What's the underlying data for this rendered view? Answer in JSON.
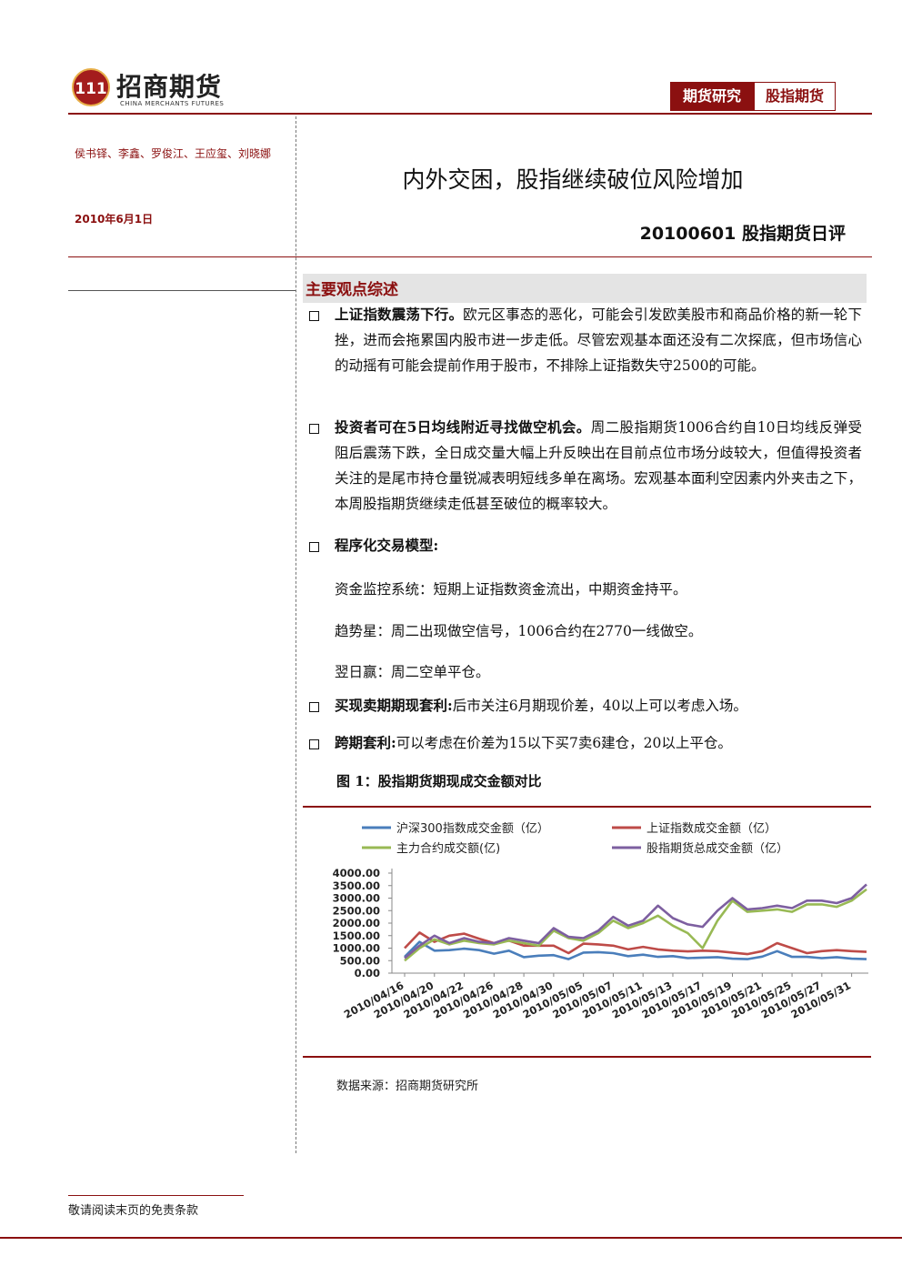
{
  "header": {
    "brand": "招商期货",
    "brand_en": "CHINA MERCHANTS FUTURES",
    "tag_primary": "期货研究",
    "tag_secondary": "股指期货"
  },
  "authors": "侯书铎、李鑫、罗俊江、王应玺、刘晓娜",
  "date": "2010年6月1日",
  "title": "内外交困，股指继续破位风险增加",
  "subtitle": "20100601 股指期货日评",
  "section_title": "主要观点综述",
  "points": [
    {
      "lead": "上证指数震荡下行。",
      "text": "欧元区事态的恶化，可能会引发欧美股市和商品价格的新一轮下挫，进而会拖累国内股市进一步走低。尽管宏观基本面还没有二次探底，但市场信心的动摇有可能会提前作用于股市，不排除上证指数失守2500的可能。"
    },
    {
      "lead": "投资者可在5日均线附近寻找做空机会。",
      "text": "周二股指期货1006合约自10日均线反弹受阻后震荡下跌，全日成交量大幅上升反映出在目前点位市场分歧较大，但值得投资者关注的是尾市持仓量锐减表明短线多单在离场。宏观基本面利空因素内外夹击之下，本周股指期货继续走低甚至破位的概率较大。"
    },
    {
      "lead": "程序化交易模型:",
      "text": ""
    }
  ],
  "model_lines": [
    "资金监控系统：短期上证指数资金流出，中期资金持平。",
    "趋势星：周二出现做空信号，1006合约在2770一线做空。",
    "翌日赢：周二空单平仓。"
  ],
  "arbitrage": [
    {
      "lead": "买现卖期期现套利:",
      "text": "后市关注6月期现价差，40以上可以考虑入场。"
    },
    {
      "lead": "跨期套利:",
      "text": "可以考虑在价差为15以下买7卖6建仓，20以上平仓。"
    }
  ],
  "figure_title": "图 1：股指期货期现成交金额对比",
  "chart_data": {
    "type": "line",
    "x": [
      "2010/04/16",
      "2010/04/19",
      "2010/04/20",
      "2010/04/21",
      "2010/04/22",
      "2010/04/23",
      "2010/04/26",
      "2010/04/27",
      "2010/04/28",
      "2010/04/29",
      "2010/04/30",
      "2010/05/04",
      "2010/05/05",
      "2010/05/06",
      "2010/05/07",
      "2010/05/10",
      "2010/05/11",
      "2010/05/12",
      "2010/05/13",
      "2010/05/14",
      "2010/05/17",
      "2010/05/18",
      "2010/05/19",
      "2010/05/20",
      "2010/05/21",
      "2010/05/24",
      "2010/05/25",
      "2010/05/26",
      "2010/05/27",
      "2010/05/28",
      "2010/05/31",
      "2010/06/01"
    ],
    "tick_labels": [
      "2010/04/16",
      "2010/04/20",
      "2010/04/22",
      "2010/04/26",
      "2010/04/28",
      "2010/04/30",
      "2010/05/05",
      "2010/05/07",
      "2010/05/11",
      "2010/05/13",
      "2010/05/17",
      "2010/05/19",
      "2010/05/21",
      "2010/05/25",
      "2010/05/27",
      "2010/05/31"
    ],
    "ylim": [
      0,
      4000
    ],
    "yticks": [
      "4000.00",
      "3500.00",
      "3000.00",
      "2500.00",
      "2000.00",
      "1500.00",
      "1000.00",
      "500.00",
      "0.00"
    ],
    "series": [
      {
        "name": "沪深300指数成交金额（亿）",
        "color": "#4a7ebb",
        "values": [
          650,
          1250,
          900,
          920,
          980,
          920,
          780,
          900,
          640,
          700,
          720,
          560,
          820,
          840,
          800,
          680,
          740,
          650,
          680,
          600,
          620,
          640,
          580,
          560,
          660,
          880,
          650,
          650,
          600,
          640,
          580,
          560
        ]
      },
      {
        "name": "上证指数成交金额（亿）",
        "color": "#be4b48",
        "values": [
          1000,
          1620,
          1250,
          1500,
          1580,
          1380,
          1200,
          1300,
          1100,
          1100,
          1100,
          800,
          1180,
          1150,
          1100,
          950,
          1050,
          950,
          900,
          870,
          900,
          880,
          820,
          760,
          880,
          1200,
          1000,
          800,
          880,
          920,
          880,
          850
        ]
      },
      {
        "name": "主力合约成交额(亿)",
        "color": "#98b954",
        "values": [
          500,
          1000,
          1350,
          1150,
          1300,
          1200,
          1150,
          1300,
          1200,
          1100,
          1700,
          1400,
          1300,
          1600,
          2100,
          1800,
          2000,
          2300,
          1900,
          1600,
          1000,
          2100,
          2900,
          2450,
          2500,
          2550,
          2450,
          2750,
          2750,
          2650,
          2900,
          3350
        ]
      },
      {
        "name": "股指期货总成交金额（亿）",
        "color": "#7d5fa0",
        "values": [
          600,
          1100,
          1500,
          1200,
          1400,
          1250,
          1200,
          1400,
          1300,
          1200,
          1800,
          1450,
          1400,
          1700,
          2250,
          1900,
          2100,
          2700,
          2200,
          1950,
          1850,
          2500,
          3000,
          2550,
          2600,
          2700,
          2600,
          2900,
          2900,
          2800,
          3000,
          3550
        ]
      }
    ]
  },
  "source": "数据来源：招商期货研究所",
  "footer": "敬请阅读末页的免责条款"
}
